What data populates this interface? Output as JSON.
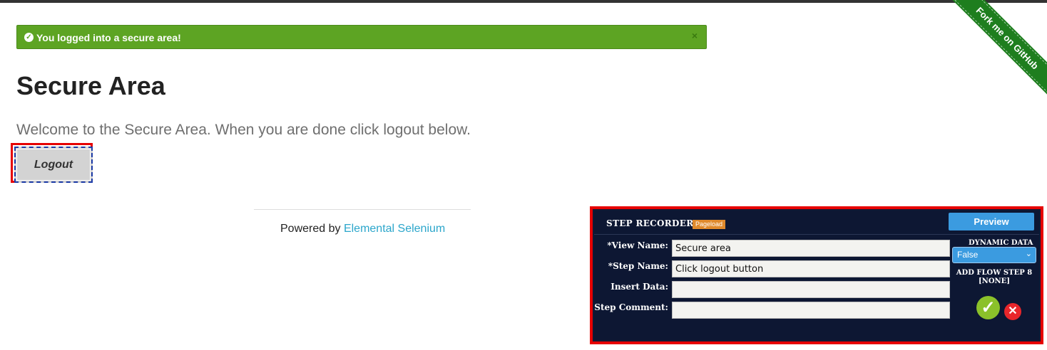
{
  "flash": {
    "message": "You logged into a secure area!",
    "close": "×"
  },
  "page": {
    "title": "Secure Area",
    "subheader": "Welcome to the Secure Area. When you are done click logout below.",
    "logout_label": "Logout"
  },
  "footer": {
    "prefix": "Powered by ",
    "link": "Elemental Selenium"
  },
  "ribbon": {
    "label": "Fork me on GitHub"
  },
  "recorder": {
    "title": "STEP RECORDER",
    "badge": "Pageload",
    "preview_label": "Preview",
    "fields": [
      {
        "label": "*View Name:",
        "value": "Secure area"
      },
      {
        "label": "*Step Name:",
        "value": "Click logout button"
      },
      {
        "label": "Insert Data:",
        "value": ""
      },
      {
        "label": "Step Comment:",
        "value": ""
      }
    ],
    "dynamic_data_title": "DYNAMIC DATA",
    "dynamic_data_value": "False",
    "flow_step_line1": "ADD FLOW STEP 8",
    "flow_step_line2": "[NONE]"
  },
  "colors": {
    "flash": "#5da423",
    "highlight": "#e60000",
    "recorder_bg": "#0d1733",
    "link": "#2ba6cb"
  }
}
